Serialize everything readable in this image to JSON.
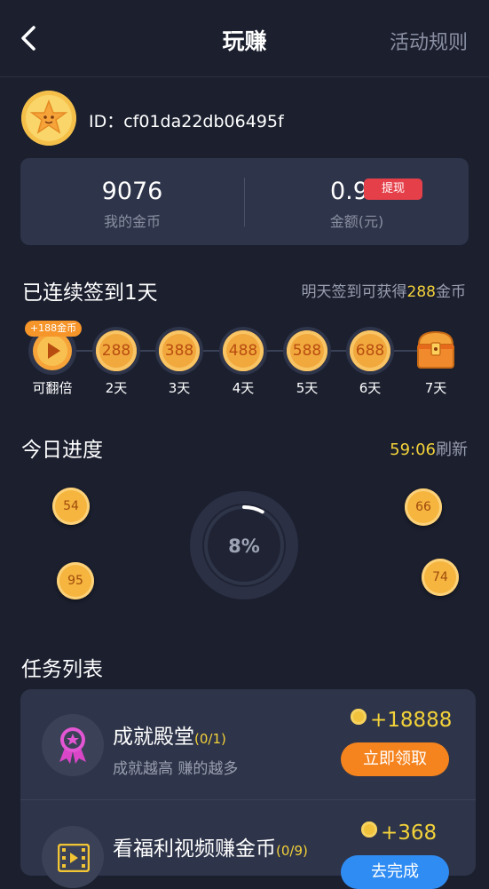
{
  "header": {
    "title": "玩赚",
    "rules": "活动规则"
  },
  "user": {
    "id_text": "ID：cf01da22db06495f"
  },
  "wallet": {
    "coins_value": "9076",
    "coins_label": "我的金币",
    "amount_value": "0.91",
    "amount_label": "金额(元)",
    "withdraw": "提现"
  },
  "signin": {
    "title": "已连续签到1天",
    "hint_prefix": "明天签到可获得",
    "hint_amount": "288",
    "hint_suffix": "金币",
    "bonus_tag": "+188金币",
    "days": [
      {
        "coin": "",
        "label": "可翻倍"
      },
      {
        "coin": "288",
        "label": "2天"
      },
      {
        "coin": "388",
        "label": "3天"
      },
      {
        "coin": "488",
        "label": "4天"
      },
      {
        "coin": "588",
        "label": "5天"
      },
      {
        "coin": "688",
        "label": "6天"
      },
      {
        "coin": "",
        "label": "7天"
      }
    ]
  },
  "today": {
    "title": "今日进度",
    "time": "59:06",
    "refresh": "刷新",
    "progress_text": "8%",
    "progress_value": 0.08,
    "bubbles": [
      "54",
      "95",
      "66",
      "74"
    ]
  },
  "tasks": {
    "title": "任务列表",
    "items": [
      {
        "title": "成就殿堂",
        "count": "(0/1)",
        "desc": "成就越高 赚的越多",
        "reward": "+18888",
        "button": "立即领取",
        "button_color": "#f5841f"
      },
      {
        "title": "看福利视频赚金币",
        "count": "(0/9)",
        "desc": "",
        "reward": "+368",
        "button": "去完成",
        "button_color": "#2f8cf3"
      }
    ]
  },
  "colors": {
    "bg": "#1b1f2e",
    "card": "#2e3449",
    "accent": "#f3d23a",
    "badge": "#e5404a"
  }
}
